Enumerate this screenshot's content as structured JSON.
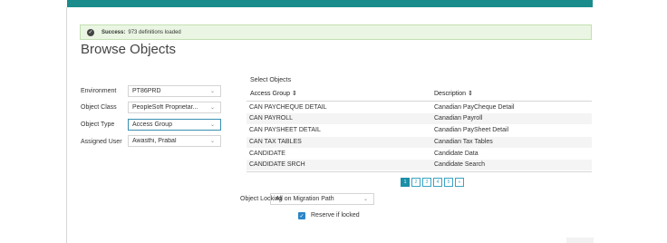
{
  "alert": {
    "strong": "Success:",
    "message": "973 definitions loaded"
  },
  "page": {
    "title": "Browse Objects"
  },
  "form": {
    "environment": {
      "label": "Environment",
      "value": "PT86PRD"
    },
    "object_class": {
      "label": "Object Class",
      "value": "PeopleSoft Proprietar..."
    },
    "object_type": {
      "label": "Object Type",
      "value": "Access Group"
    },
    "assigned_user": {
      "label": "Assigned User",
      "value": "Awasthi, Prabal"
    }
  },
  "objects": {
    "title": "Select Objects",
    "col1": "Access Group ⇕",
    "col2": "Description ⇕",
    "rows": [
      {
        "name": "CAN PAYCHEQUE DETAIL",
        "desc": "Canadian PayCheque Detail"
      },
      {
        "name": "CAN PAYROLL",
        "desc": "Canadian Payroll"
      },
      {
        "name": "CAN PAYSHEET DETAIL",
        "desc": "Canadian PaySheet Detail"
      },
      {
        "name": "CAN TAX TABLES",
        "desc": "Canadian Tax Tables"
      },
      {
        "name": "CANDIDATE",
        "desc": "Candidate Data"
      },
      {
        "name": "CANDIDATE SRCH",
        "desc": "Candidate Search"
      }
    ]
  },
  "pagination": {
    "pages": [
      "1",
      "2",
      "3",
      "4",
      "5",
      "»"
    ],
    "current": "1"
  },
  "locking": {
    "label": "Object Locking",
    "value": "All on Migration Path",
    "reserve_label": "Reserve if locked"
  },
  "icons": {
    "check": "check-circle-icon",
    "chevron": "chevron-down-icon",
    "sort": "sort-icon"
  },
  "colors": {
    "accent": "#1b8fa8",
    "success_bg": "#eaf6e3",
    "topbar": "#1a8c8c"
  }
}
